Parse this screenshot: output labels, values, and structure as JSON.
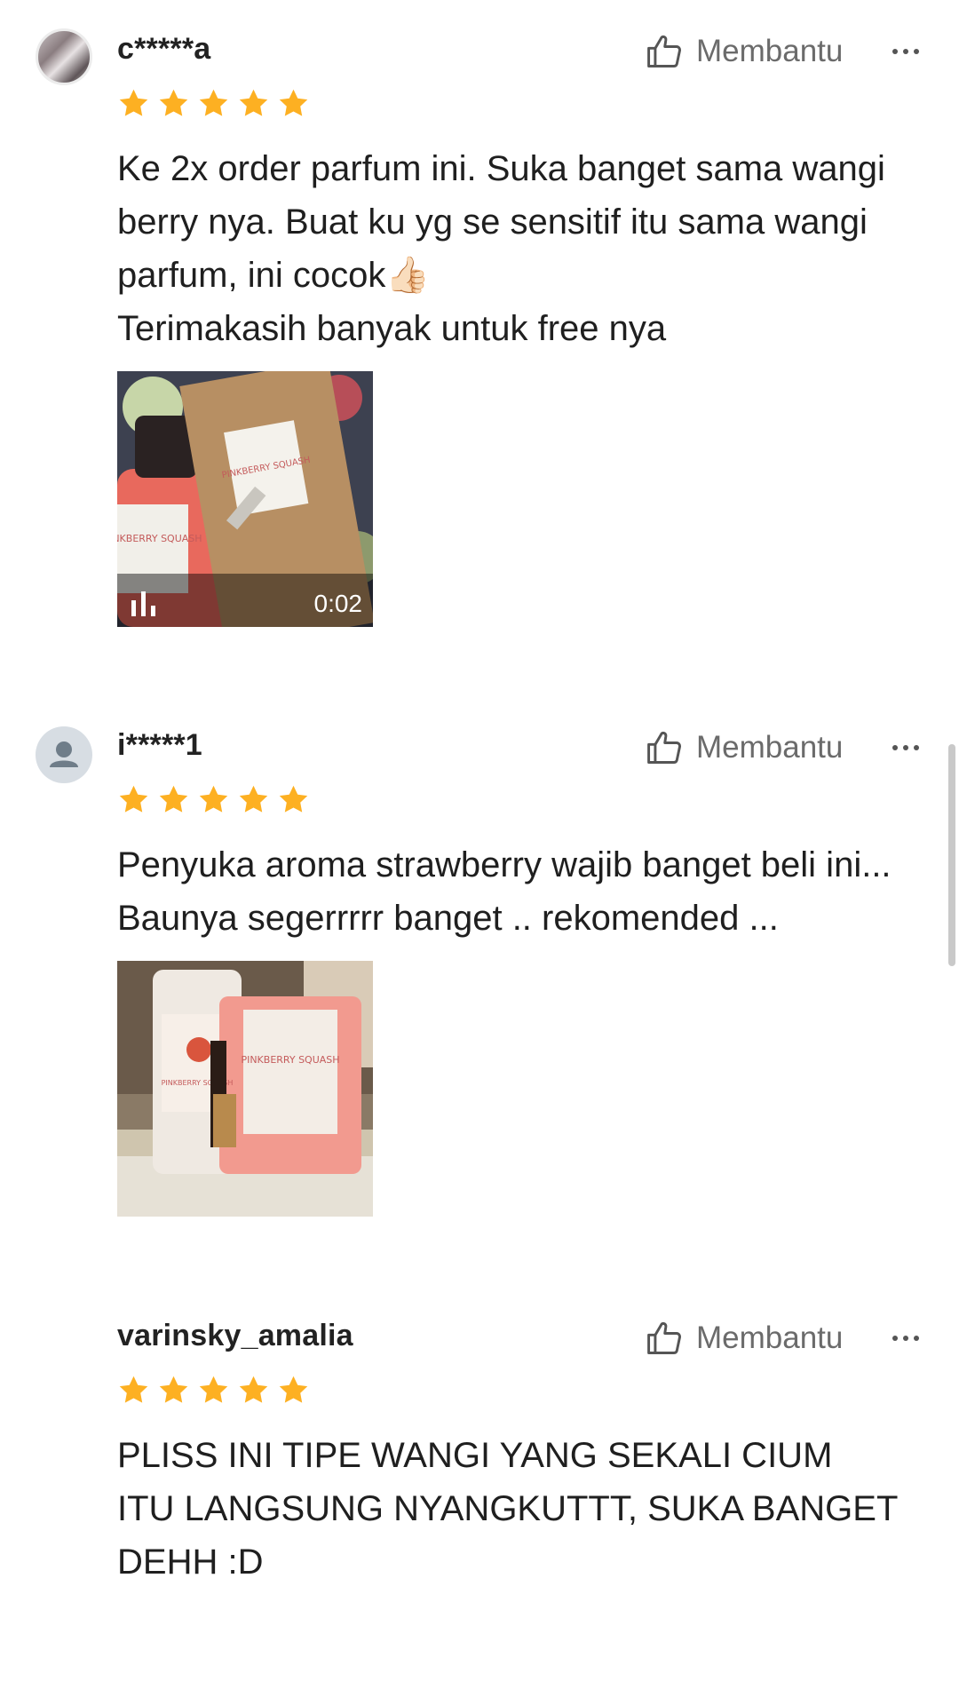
{
  "reviews": [
    {
      "username": "c*****a",
      "helpful_label": "Membantu",
      "rating": 5,
      "text_lines": [
        "Ke 2x order parfum ini. Suka banget sama wangi berry nya. Buat ku yg se sensitif itu sama wangi parfum, ini cocok👍🏻",
        "Terimakasih banyak untuk free nya"
      ],
      "media": {
        "type": "video",
        "duration": "0:02",
        "label_front": "PINKBERRY SQUASH",
        "label_back": "PINKBERRY SQUASH"
      }
    },
    {
      "username": "i*****1",
      "helpful_label": "Membantu",
      "rating": 5,
      "text_lines": [
        "Penyuka aroma strawberry wajib banget beli ini... Baunya segerrrrr banget .. rekomended ..."
      ],
      "media": {
        "type": "photo",
        "label_main": "PINKBERRY SQUASH",
        "label_back": "PINKBERRY SQUASH"
      }
    },
    {
      "username": "varinsky_amalia",
      "helpful_label": "Membantu",
      "rating": 5,
      "text_lines": [
        "PLISS INI TIPE WANGI YANG SEKALI CIUM ITU LANGSUNG NYANGKUTTT, SUKA BANGET DEHH :D"
      ]
    }
  ],
  "colors": {
    "star": "#FDB022",
    "muted_text": "#6b6b6b",
    "primary_text": "#1f1f1f"
  },
  "icons": [
    "thumbs-up-icon",
    "more-dots-icon",
    "star-icon",
    "user-icon",
    "audio-bars-icon"
  ]
}
